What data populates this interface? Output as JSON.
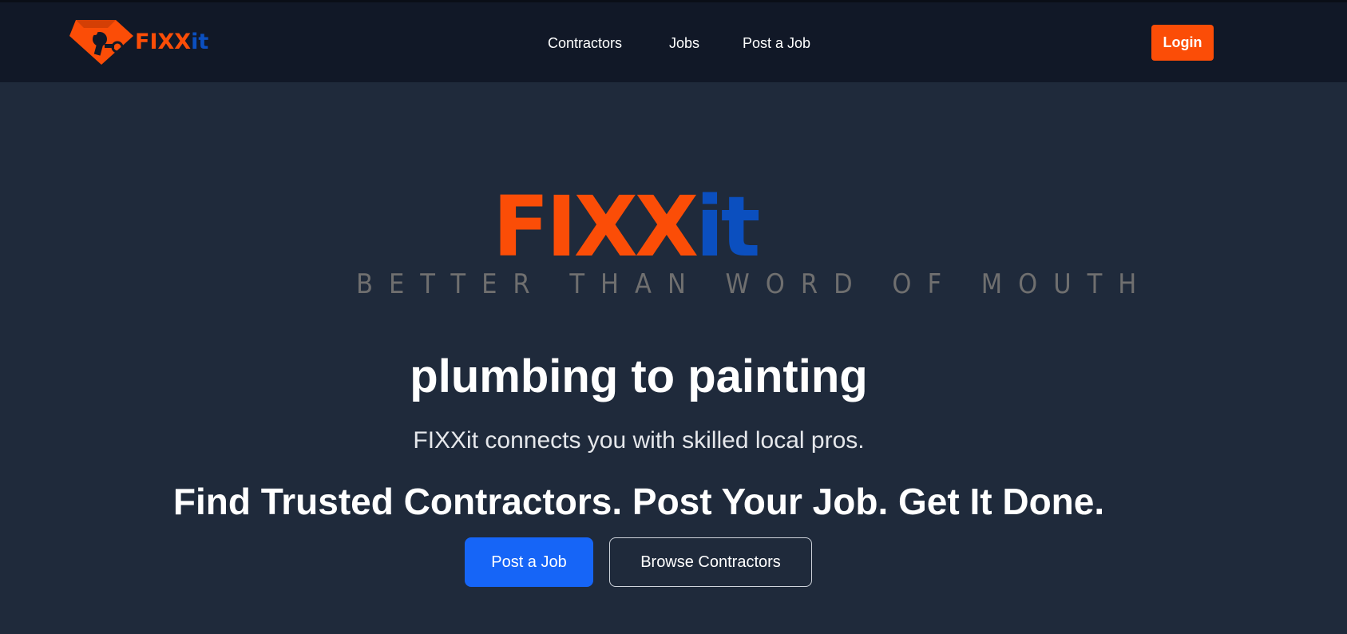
{
  "brand": {
    "name_part1": "FIXX",
    "name_part2": "it",
    "tagline": "BETTER THAN WORD OF MOUTH"
  },
  "colors": {
    "accent_orange": "#fb4d07",
    "accent_blue": "#0b4fbf",
    "primary_button": "#1665f7",
    "nav_background": "#111827",
    "page_background": "#1f2a3b"
  },
  "nav": {
    "items": [
      {
        "label": "Contractors"
      },
      {
        "label": "Jobs"
      },
      {
        "label": "Post a Job"
      }
    ],
    "login_label": "Login"
  },
  "hero": {
    "headline": "plumbing to painting",
    "subtext": "FIXXit connects you with skilled local pros.",
    "cta_line": "Find Trusted Contractors. Post Your Job. Get It Done.",
    "primary_button": "Post a Job",
    "secondary_button": "Browse Contractors"
  },
  "icons": {
    "logo_mark": "wrench-diamond-icon"
  }
}
